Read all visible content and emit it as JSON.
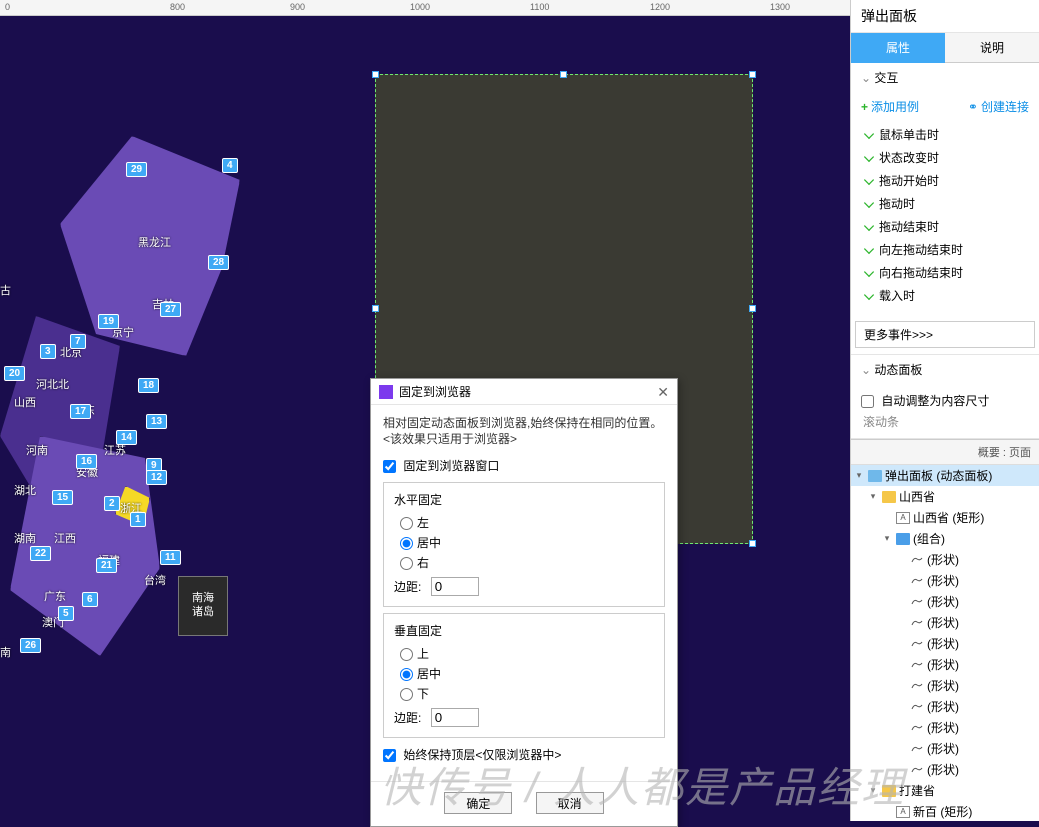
{
  "ruler_ticks": [
    "0",
    "800",
    "900",
    "1000",
    "1100",
    "1200",
    "1300"
  ],
  "map": {
    "provinces": {
      "heilongjiang": "黑龙江",
      "neimenggu": "古",
      "beijing": "北京",
      "liaoning": "京宁",
      "hebeibei": "河北北",
      "shanxi": "山西",
      "dong": "东",
      "henan": "河南",
      "anhui": "安徽",
      "hubei": "湖北",
      "jiangsu": "江苏",
      "zhejiang": "浙江",
      "hunan": "湖南",
      "jiangxi": "江西",
      "fujian": "福建",
      "taiwan": "台湾",
      "guangdong": "广东",
      "aomenxiang": "澳门",
      "hainan": "南",
      "jilin": "吉林"
    },
    "markers": {
      "m29": "29",
      "m4": "4",
      "m28": "28",
      "m27": "27",
      "m19": "19",
      "m7": "7",
      "m3": "3",
      "m20": "20",
      "m18": "18",
      "m17": "17",
      "m13": "13",
      "m14": "14",
      "m16": "16",
      "m15": "15",
      "m9": "9",
      "m12": "12",
      "m2": "2",
      "m1": "1",
      "m22": "22",
      "m21": "21",
      "m11": "11",
      "m6": "6",
      "m5": "5",
      "m26": "26"
    },
    "nanhai_l1": "南海",
    "nanhai_l2": "诸岛"
  },
  "dialog": {
    "title": "固定到浏览器",
    "desc": "相对固定动态面板到浏览器,始终保持在相同的位置。<该效果只适用于浏览器>",
    "pin_checkbox": "固定到浏览器窗口",
    "horizontal": {
      "legend": "水平固定",
      "left": "左",
      "center": "居中",
      "right": "右",
      "margin_label": "边距:",
      "margin_value": "0"
    },
    "vertical": {
      "legend": "垂直固定",
      "top": "上",
      "center": "居中",
      "bottom": "下",
      "margin_label": "边距:",
      "margin_value": "0"
    },
    "keep_top": "始终保持顶层<仅限浏览器中>",
    "ok": "确定",
    "cancel": "取消"
  },
  "rpanel": {
    "title": "弹出面板",
    "tab_props": "属性",
    "tab_desc": "说明",
    "interaction": {
      "head": "交互",
      "add_case": "添加用例",
      "create_link": "创建连接",
      "events": [
        "鼠标单击时",
        "状态改变时",
        "拖动开始时",
        "拖动时",
        "拖动结束时",
        "向左拖动结束时",
        "向右拖动结束时",
        "载入时"
      ],
      "more": "更多事件>>>"
    },
    "dynamic": {
      "head": "动态面板",
      "auto_size": "自动调整为内容尺寸",
      "scrollbar": "滚动条"
    }
  },
  "outline": {
    "head": "概要 : 页面",
    "items": [
      {
        "depth": 0,
        "arrow": "▾",
        "icon": "page",
        "label": "弹出面板 (动态面板)",
        "selected": true
      },
      {
        "depth": 1,
        "arrow": "▾",
        "icon": "folder",
        "label": "山西省"
      },
      {
        "depth": 2,
        "arrow": "",
        "icon": "text",
        "label": "山西省 (矩形)"
      },
      {
        "depth": 2,
        "arrow": "▾",
        "icon": "folder-blue",
        "label": "(组合)"
      },
      {
        "depth": 3,
        "arrow": "",
        "icon": "shape",
        "label": "(形状)"
      },
      {
        "depth": 3,
        "arrow": "",
        "icon": "shape",
        "label": "(形状)"
      },
      {
        "depth": 3,
        "arrow": "",
        "icon": "shape",
        "label": "(形状)"
      },
      {
        "depth": 3,
        "arrow": "",
        "icon": "shape",
        "label": "(形状)"
      },
      {
        "depth": 3,
        "arrow": "",
        "icon": "shape",
        "label": "(形状)"
      },
      {
        "depth": 3,
        "arrow": "",
        "icon": "shape",
        "label": "(形状)"
      },
      {
        "depth": 3,
        "arrow": "",
        "icon": "shape",
        "label": "(形状)"
      },
      {
        "depth": 3,
        "arrow": "",
        "icon": "shape",
        "label": "(形状)"
      },
      {
        "depth": 3,
        "arrow": "",
        "icon": "shape",
        "label": "(形状)"
      },
      {
        "depth": 3,
        "arrow": "",
        "icon": "shape",
        "label": "(形状)"
      },
      {
        "depth": 3,
        "arrow": "",
        "icon": "shape",
        "label": "(形状)"
      },
      {
        "depth": 1,
        "arrow": "▾",
        "icon": "folder",
        "label": "打建省"
      },
      {
        "depth": 2,
        "arrow": "",
        "icon": "text",
        "label": "新百 (矩形)"
      }
    ]
  },
  "watermark": "快传号 / 人人都是产品经理"
}
